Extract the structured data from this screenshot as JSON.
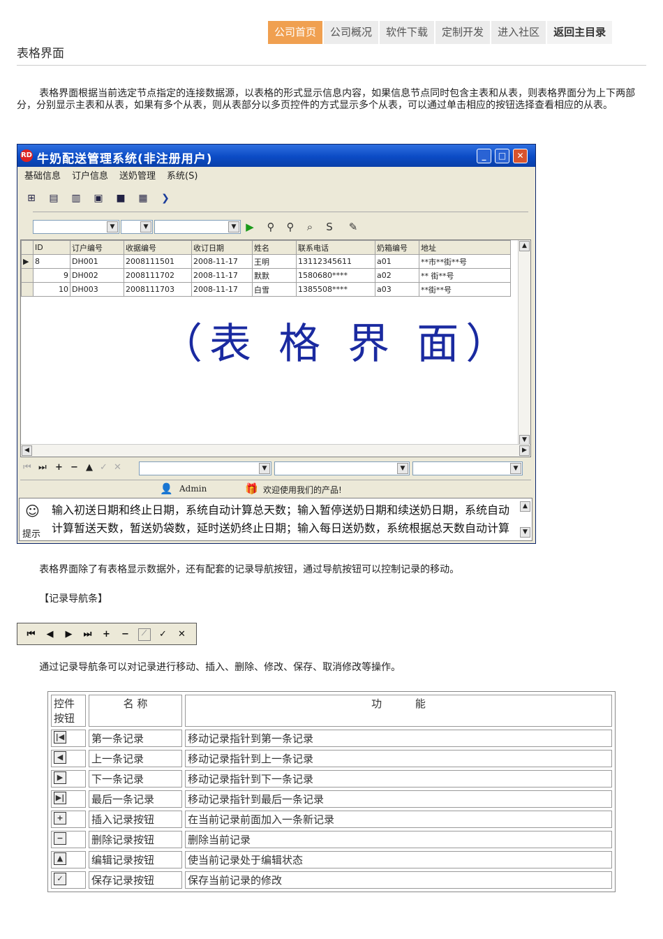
{
  "nav": {
    "items": [
      "公司首页",
      "公司概况",
      "软件下载",
      "定制开发",
      "进入社区",
      "返回主目录"
    ]
  },
  "page_title": "表格界面",
  "intro": "表格界面根据当前选定节点指定的连接数据源，以表格的形式显示信息内容，如果信息节点同时包含主表和从表，则表格界面分为上下两部分，分别显示主表和从表，如果有多个从表，则从表部分以多页控件的方式显示多个从表，可以通过单击相应的按钮选择查看相应的从表。",
  "app": {
    "title": "牛奶配送管理系统(非注册用户)",
    "logo": "RD",
    "menu": [
      "基础信息",
      "订户信息",
      "送奶管理",
      "系统(S)"
    ],
    "grid": {
      "columns": [
        "ID",
        "订户编号",
        "收据编号",
        "收订日期",
        "姓名",
        "联系电话",
        "奶箱编号",
        "地址"
      ],
      "rows": [
        {
          "id": "8",
          "code": "DH001",
          "receipt": "2008111501",
          "date": "2008-11-17",
          "name": "王明",
          "phone": "13112345611",
          "box": "a01",
          "addr": "**市**街**号"
        },
        {
          "id": "9",
          "code": "DH002",
          "receipt": "2008111702",
          "date": "2008-11-17",
          "name": "默默",
          "phone": "1580680****",
          "box": "a02",
          "addr": "** 街**号"
        },
        {
          "id": "10",
          "code": "DH003",
          "receipt": "2008111703",
          "date": "2008-11-17",
          "name": "白雪",
          "phone": "1385508****",
          "box": "a03",
          "addr": "**街**号"
        }
      ]
    },
    "watermark": "（表 格 界 面）",
    "status": {
      "user": "Admin",
      "welcome": "欢迎使用我们的产品!"
    },
    "hint_label": "提示",
    "hint_text": "输入初送日期和终止日期，系统自动计算总天数；输入暂停送奶日期和续送奶日期，系统自动计算暂送天数，暂送奶袋数，延时送奶终止日期；输入每日送奶数，系统根据总天数自动计算数量"
  },
  "para2": "表格界面除了有表格显示数据外，还有配套的记录导航按钮，通过导航按钮可以控制记录的移动。",
  "section_label": "【记录导航条】",
  "para3": "通过记录导航条可以对记录进行移动、插入、删除、修改、保存、取消修改等操作。",
  "func_table": {
    "headers": [
      "控件按钮",
      "名  称",
      "功          能"
    ],
    "rows": [
      {
        "icon": "first-record-icon",
        "name": "第一条记录",
        "func": "移动记录指针到第一条记录"
      },
      {
        "icon": "prior-record-icon",
        "name": "上一条记录",
        "func": "移动记录指针到上一条记录"
      },
      {
        "icon": "next-record-icon",
        "name": "下一条记录",
        "func": "移动记录指针到下一条记录"
      },
      {
        "icon": "last-record-icon",
        "name": "最后一条记录",
        "func": "移动记录指针到最后一条记录"
      },
      {
        "icon": "insert-record-icon",
        "name": "插入记录按钮",
        "func": "在当前记录前面加入一条新记录"
      },
      {
        "icon": "delete-record-icon",
        "name": "删除记录按钮",
        "func": "删除当前记录"
      },
      {
        "icon": "edit-record-icon",
        "name": "编辑记录按钮",
        "func": "使当前记录处于编辑状态"
      },
      {
        "icon": "post-record-icon",
        "name": "保存记录按钮",
        "func": "保存当前记录的修改"
      }
    ]
  }
}
